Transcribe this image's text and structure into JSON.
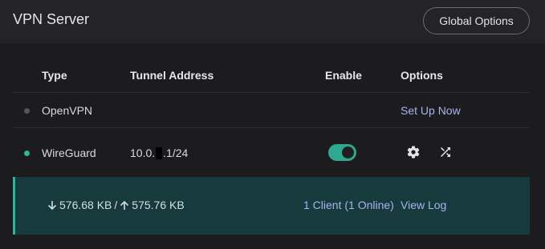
{
  "header": {
    "title": "VPN Server",
    "global_options_label": "Global Options"
  },
  "table": {
    "columns": [
      "Type",
      "Tunnel Address",
      "Enable",
      "Options"
    ],
    "rows": [
      {
        "type": "OpenVPN",
        "status_color": "#55555b",
        "tunnel_address": "",
        "enabled": null,
        "option_link": "Set Up Now"
      },
      {
        "type": "WireGuard",
        "status_color": "#2fb495",
        "tunnel_address_prefix": "10.0.",
        "tunnel_address_suffix": ".1/24",
        "enabled": true,
        "option_icons": [
          "gear-icon",
          "shuffle-icon"
        ]
      }
    ]
  },
  "stats": {
    "download": "576.68 KB",
    "separator": "/",
    "upload": "575.76 KB",
    "clients": "1 Client (1 Online)",
    "view_log_label": "View Log"
  },
  "colors": {
    "accent": "#2fb495",
    "link": "#a9b2f0",
    "stats_bg": "#173a3c"
  }
}
